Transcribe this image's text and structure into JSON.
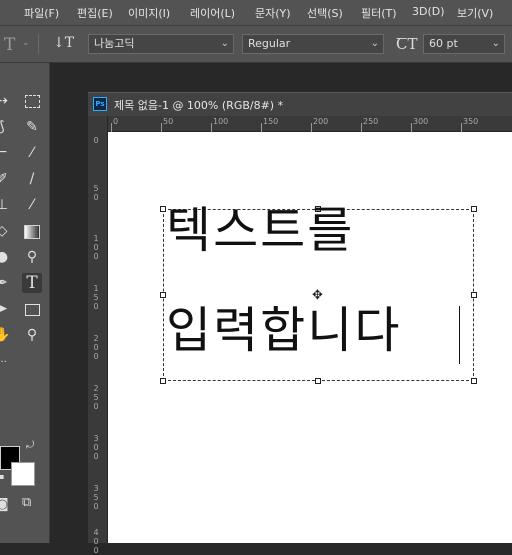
{
  "menubar": {
    "items": [
      "파일(F)",
      "편집(E)",
      "이미지(I)",
      "레이어(L)",
      "문자(Y)",
      "선택(S)",
      "필터(T)",
      "3D(D)",
      "보기(V)"
    ]
  },
  "options": {
    "tool_icon": "type-tool-icon",
    "orientation_icon": "text-orientation-icon",
    "font_family": "나눔고딕",
    "font_style": "Regular",
    "font_size_icon": "font-size-icon",
    "font_size": "60 pt"
  },
  "document": {
    "tab_badge": "Ps",
    "tab_title": "제목 없음-1 @ 100% (RGB/8#) *",
    "ruler_top_labels": [
      "0",
      "50",
      "100",
      "150",
      "200",
      "250",
      "300",
      "350"
    ],
    "ruler_left_labels": [
      "0",
      "5 0",
      "1 0 0",
      "1 5 0",
      "2 0 0",
      "2 5 0",
      "3 0 0",
      "3 5 0",
      "4 0 0"
    ]
  },
  "canvas_text": {
    "line1": "텍스트를",
    "line2": "입력합니다"
  },
  "colors": {
    "foreground": "#000000",
    "background": "#ffffff",
    "ps_accent": "#31a8ff"
  }
}
